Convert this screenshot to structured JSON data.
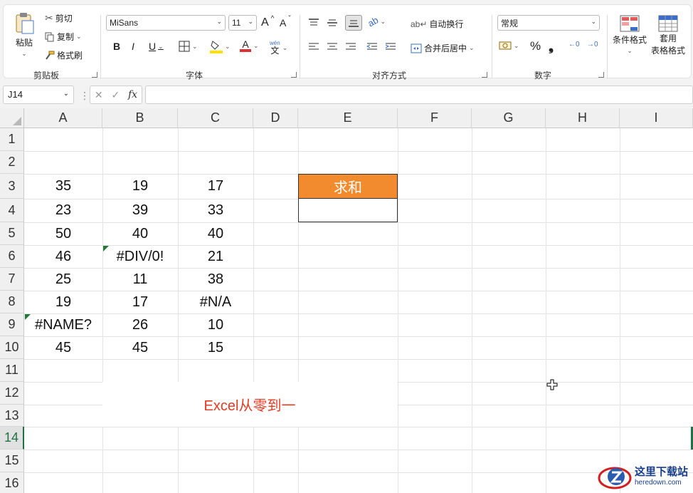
{
  "ribbon": {
    "clipboard": {
      "paste": "粘贴",
      "cut": "剪切",
      "copy": "复制",
      "format_painter": "格式刷",
      "group": "剪贴板"
    },
    "font": {
      "name": "MiSans",
      "size": "11",
      "group": "字体",
      "bold": "B",
      "italic": "I",
      "underline": "U",
      "grow": "A",
      "shrink": "A",
      "font_color_letter": "A",
      "phonetic": "wén",
      "phonetic_char": "文"
    },
    "alignment": {
      "wrap": "自动换行",
      "merge": "合并后居中",
      "group": "对齐方式"
    },
    "number": {
      "format": "常规",
      "group": "数字",
      "percent": "%",
      "comma": "❟",
      "inc_dec": "←0",
      "dec_dec": "→0"
    },
    "styles": {
      "conditional": "条件格式",
      "table_format_1": "套用",
      "table_format_2": "表格格式"
    }
  },
  "formula_bar": {
    "name_box": "J14",
    "fx": "fx",
    "cancel": "✕",
    "enter": "✓",
    "formula": ""
  },
  "sheet": {
    "columns": [
      "A",
      "B",
      "C",
      "D",
      "E",
      "F",
      "G",
      "H",
      "I"
    ],
    "rows": [
      "1",
      "2",
      "3",
      "4",
      "5",
      "6",
      "7",
      "8",
      "9",
      "10",
      "11",
      "12",
      "13",
      "14",
      "15",
      "16"
    ],
    "data": [
      [
        "35",
        "19",
        "17"
      ],
      [
        "23",
        "39",
        "33"
      ],
      [
        "50",
        "40",
        "40"
      ],
      [
        "46",
        "#DIV/0!",
        "21"
      ],
      [
        "25",
        "11",
        "38"
      ],
      [
        "19",
        "17",
        "#N/A"
      ],
      [
        "#NAME?",
        "26",
        "10"
      ],
      [
        "45",
        "45",
        "15"
      ]
    ],
    "sum_header": "求和",
    "sum_value": "",
    "caption": "Excel从零到一"
  },
  "watermark": {
    "name": "这里下载站",
    "url": "heredown.com"
  },
  "colors": {
    "accent": "#1e7145",
    "header_fill": "#f28a2e",
    "caption": "#e23b23"
  }
}
